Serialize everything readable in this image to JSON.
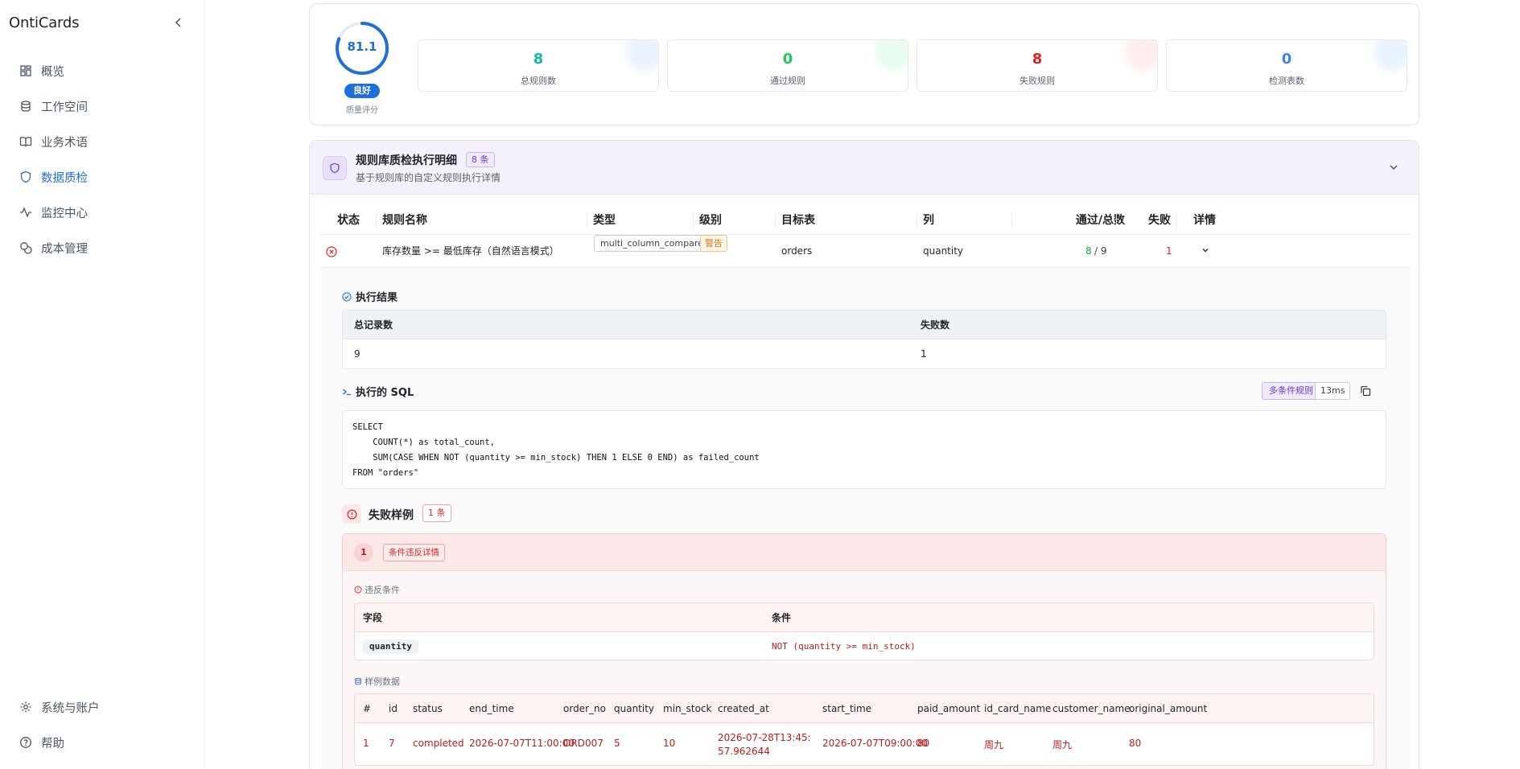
{
  "app": {
    "name": "OntiCards"
  },
  "sidebar": {
    "items": [
      {
        "label": "概览",
        "icon": "dashboard-icon"
      },
      {
        "label": "工作空间",
        "icon": "database-icon"
      },
      {
        "label": "业务术语",
        "icon": "book-icon"
      },
      {
        "label": "数据质检",
        "icon": "shield-icon",
        "active": true
      },
      {
        "label": "监控中心",
        "icon": "activity-icon"
      },
      {
        "label": "成本管理",
        "icon": "coins-icon"
      }
    ],
    "bottom": [
      {
        "label": "系统与账户",
        "icon": "gear-icon"
      },
      {
        "label": "帮助",
        "icon": "help-icon"
      }
    ]
  },
  "score": {
    "value": "81.1",
    "percent": 81.1,
    "badge": "良好",
    "label": "质量评分"
  },
  "stats": [
    {
      "value": "8",
      "label": "总规则数",
      "color": "#14b8a6"
    },
    {
      "value": "0",
      "label": "通过规则",
      "color": "#22c55e"
    },
    {
      "value": "8",
      "label": "失败规则",
      "color": "#dc2626"
    },
    {
      "value": "0",
      "label": "检测表数",
      "color": "#3b82f6"
    }
  ],
  "rules": {
    "title": "规则库质检执行明细",
    "count": "8 条",
    "subtitle": "基于规则库的自定义规则执行详情",
    "columns": {
      "status": "状态",
      "name": "规则名称",
      "type": "类型",
      "level": "级别",
      "table": "目标表",
      "column": "列",
      "pass_total": "通过/总数",
      "fail": "失败",
      "detail": "详情"
    },
    "row": {
      "name": "库存数量 >= 最低库存（自然语言模式）",
      "type": "multi_column_compare",
      "level": "警告",
      "table": "orders",
      "column": "quantity",
      "passed": "8",
      "total": "/ 9",
      "failed": "1"
    }
  },
  "result": {
    "title": "执行结果",
    "headers": [
      "总记录数",
      "失败数"
    ],
    "values": [
      "9",
      "1"
    ]
  },
  "sql": {
    "title": "执行的 SQL",
    "tag": "多条件规则",
    "duration": "13ms",
    "code": "SELECT\n    COUNT(*) as total_count,\n    SUM(CASE WHEN NOT (quantity >= min_stock) THEN 1 ELSE 0 END) as failed_count\nFROM \"orders\""
  },
  "failures": {
    "title": "失败样例",
    "count": "1 条",
    "item": {
      "index": "1",
      "tag": "条件违反详情",
      "violation_label": "违反条件",
      "cond_headers": [
        "字段",
        "条件"
      ],
      "field": "quantity",
      "condition": "NOT (quantity >= min_stock)",
      "sample_label": "样例数据",
      "sample_headers": [
        "#",
        "id",
        "status",
        "end_time",
        "order_no",
        "quantity",
        "min_stock",
        "created_at",
        "start_time",
        "paid_amount",
        "id_card_name",
        "customer_name",
        "original_amount"
      ],
      "sample_row": [
        "1",
        "7",
        "completed",
        "2026-07-07T11:00:00",
        "ORD007",
        "5",
        "10",
        "2026-07-28T13:45:57.962644",
        "2026-07-07T09:00:00",
        "80",
        "周九",
        "周九",
        "80"
      ]
    }
  }
}
